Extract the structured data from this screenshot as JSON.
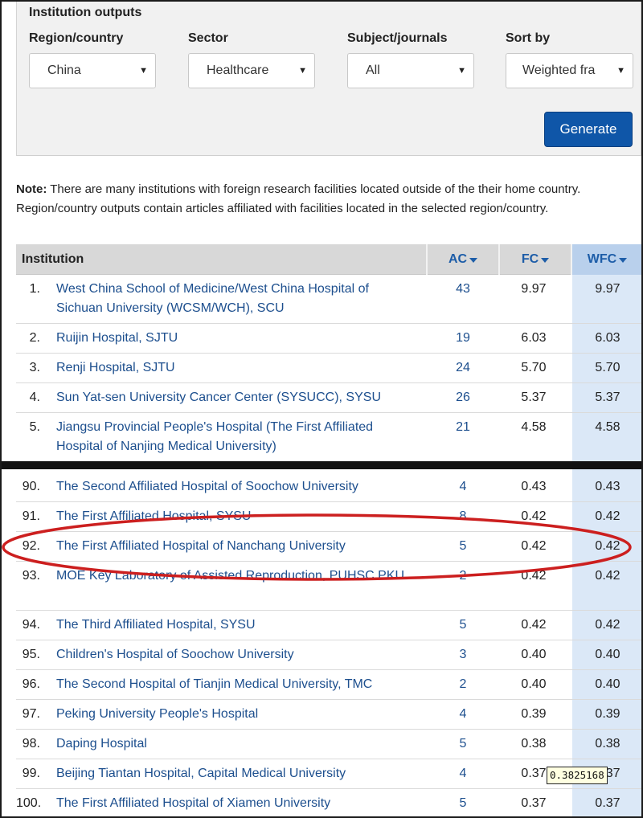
{
  "filters": {
    "panel_title": "Institution outputs",
    "region": {
      "label": "Region/country",
      "value": "China"
    },
    "sector": {
      "label": "Sector",
      "value": "Healthcare"
    },
    "subject": {
      "label": "Subject/journals",
      "value": "All"
    },
    "sort": {
      "label": "Sort by",
      "value": "Weighted fra"
    },
    "generate_label": "Generate",
    "dropdown_icon": "caret-down-icon"
  },
  "note": {
    "bold": "Note:",
    "text": " There are many institutions with foreign research facilities located outside of the their home country. Region/country outputs contain articles affiliated with facilities located in the selected region/country."
  },
  "table": {
    "headers": {
      "institution": "Institution",
      "ac": "AC",
      "fc": "FC",
      "wfc": "WFC"
    },
    "top_rows": [
      {
        "rank": "1.",
        "name": "West China School of Medicine/West China Hospital of Sichuan University (WCSM/WCH), SCU",
        "ac": "43",
        "fc": "9.97",
        "wfc": "9.97"
      },
      {
        "rank": "2.",
        "name": "Ruijin Hospital, SJTU",
        "ac": "19",
        "fc": "6.03",
        "wfc": "6.03"
      },
      {
        "rank": "3.",
        "name": "Renji Hospital, SJTU",
        "ac": "24",
        "fc": "5.70",
        "wfc": "5.70"
      },
      {
        "rank": "4.",
        "name": "Sun Yat-sen University Cancer Center (SYSUCC), SYSU",
        "ac": "26",
        "fc": "5.37",
        "wfc": "5.37"
      },
      {
        "rank": "5.",
        "name": "Jiangsu Provincial People's Hospital (The First Affiliated Hospital of Nanjing Medical University)",
        "ac": "21",
        "fc": "4.58",
        "wfc": "4.58"
      }
    ],
    "bottom_rows": [
      {
        "rank": "90.",
        "name": "The Second Affiliated Hospital of Soochow University",
        "ac": "4",
        "fc": "0.43",
        "wfc": "0.43"
      },
      {
        "rank": "91.",
        "name": "The First Affiliated Hospital, SYSU",
        "ac": "8",
        "fc": "0.42",
        "wfc": "0.42"
      },
      {
        "rank": "92.",
        "name": "The First Affiliated Hospital of Nanchang University",
        "ac": "5",
        "fc": "0.42",
        "wfc": "0.42"
      },
      {
        "rank": "93.",
        "name": "MOE Key Laboratory of Assisted Reproduction, PUHSC PKU",
        "ac": "2",
        "fc": "0.42",
        "wfc": "0.42"
      },
      {
        "rank": "94.",
        "name": "The Third Affiliated Hospital, SYSU",
        "ac": "5",
        "fc": "0.42",
        "wfc": "0.42"
      },
      {
        "rank": "95.",
        "name": "Children's Hospital of Soochow University",
        "ac": "3",
        "fc": "0.40",
        "wfc": "0.40"
      },
      {
        "rank": "96.",
        "name": "The Second Hospital of Tianjin Medical University, TMC",
        "ac": "2",
        "fc": "0.40",
        "wfc": "0.40"
      },
      {
        "rank": "97.",
        "name": "Peking University People's Hospital",
        "ac": "4",
        "fc": "0.39",
        "wfc": "0.39"
      },
      {
        "rank": "98.",
        "name": "Daping Hospital",
        "ac": "5",
        "fc": "0.38",
        "wfc": "0.38"
      },
      {
        "rank": "99.",
        "name": "Beijing Tiantan Hospital, Capital Medical University",
        "ac": "4",
        "fc": "0.37",
        "wfc": "0.37"
      },
      {
        "rank": "100.",
        "name": "The First Affiliated Hospital of Xiamen University",
        "ac": "5",
        "fc": "0.37",
        "wfc": "0.37"
      }
    ],
    "tooltip": "0.3825168",
    "highlight_color": "#cc1f1f",
    "wfc_column_color": "#dbe8f7",
    "link_color": "#1d4f8e"
  }
}
